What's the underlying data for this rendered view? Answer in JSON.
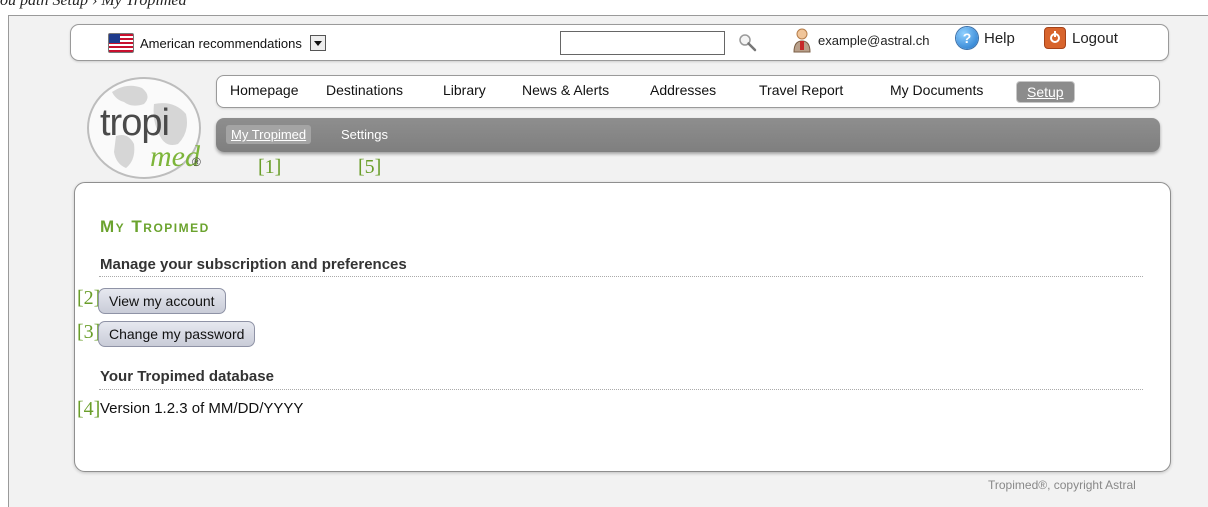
{
  "caption": "ou path Setup › My Tropimed",
  "topbar": {
    "language_label": "American recommendations",
    "search_value": "",
    "user_email": "example@astral.ch",
    "help_label": "Help",
    "logout_label": "Logout"
  },
  "logo": {
    "main": "tropi",
    "sub": "med",
    "reg": "®"
  },
  "nav": {
    "items": [
      "Homepage",
      "Destinations",
      "Library",
      "News & Alerts",
      "Addresses",
      "Travel Report",
      "My Documents",
      "Setup"
    ],
    "active": "Setup"
  },
  "subnav": {
    "items": [
      "My Tropimed",
      "Settings"
    ],
    "active": "My Tropimed"
  },
  "markers": [
    "[1]",
    "[5]",
    "[2]",
    "[3]",
    "[4]"
  ],
  "content": {
    "title": "My Tropimed",
    "section1": "Manage your subscription and preferences",
    "view_account": "View my account",
    "change_password": "Change my password",
    "section2": "Your Tropimed database",
    "version": "Version 1.2.3 of MM/DD/YYYY"
  },
  "footer": {
    "copyright": "Tropimed®, copyright Astral"
  },
  "colors": {
    "accent_green": "#6ba32e",
    "subnav_gray": "#8a8a8a",
    "button_bg": "#d8dbe4"
  }
}
